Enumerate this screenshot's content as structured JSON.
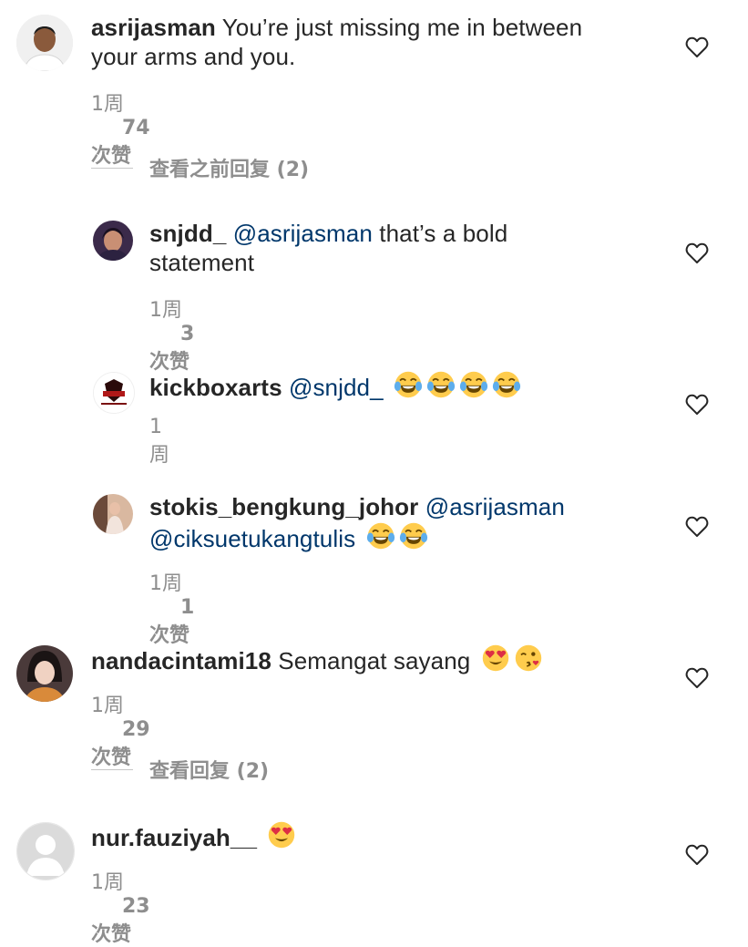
{
  "comments": [
    {
      "username": "asrijasman",
      "text": "You’re just missing me in between",
      "text2": "your arms and you.",
      "time": "1周",
      "likes": "74 次赞"
    },
    {
      "view_replies": "查看之前回复 (2)"
    },
    {
      "username": "snjdd_",
      "mention": "@asrijasman",
      "text": " that’s a bold",
      "text2": "statement",
      "time": "1周",
      "likes": "3 次赞"
    },
    {
      "username": "kickboxarts",
      "mention": "@snjdd_",
      "emoji": "face-with-tears-of-joy x4",
      "time": "1周"
    },
    {
      "username": "stokis_bengkung_johor",
      "mention": "@asrijasman",
      "mention2": "@ciksuetukangtulis",
      "emoji": "face-with-tears-of-joy x2",
      "time": "1周",
      "likes": "1 次赞"
    },
    {
      "username": "nandacintami18",
      "text": "Semangat sayang",
      "emoji": "heart-eyes, kissing-face",
      "time": "1周",
      "likes": "29 次赞"
    },
    {
      "view_replies": "查看回复 (2)"
    },
    {
      "username": "nur.fauziyah__",
      "emoji": "heart-eyes",
      "time": "1周",
      "likes": "23 次赞"
    }
  ],
  "colors": {
    "text": "#262626",
    "secondary": "#8e8e8e",
    "mention": "#00376b",
    "divider": "#c7c7c7"
  }
}
